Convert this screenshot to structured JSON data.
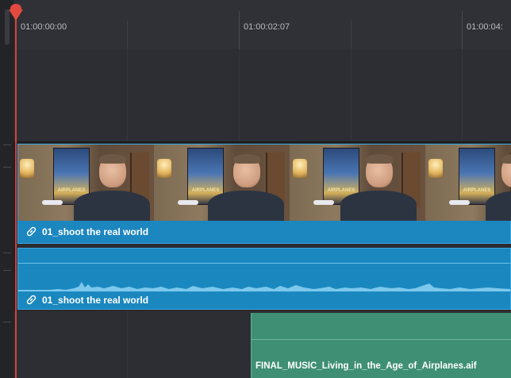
{
  "timeline": {
    "ruler": {
      "timecodes": [
        "01:00:00:00",
        "01:00:02:07",
        "01:00:04:"
      ]
    },
    "video_track": {
      "clip_name": "01_shoot the real world",
      "thumbnail_poster_text": "AIRPLANES"
    },
    "audio_track_1": {
      "clip_name": "01_shoot the real world"
    },
    "audio_track_2": {
      "clip_name": "FINAL_MUSIC_Living_in_the_Age_of_Airplanes.aif"
    }
  },
  "colors": {
    "playhead": "#e24a3f",
    "video_clip": "#1a7fb3",
    "audio_clip": "#1a88bf",
    "music_clip": "#3f8f74"
  },
  "icons": {
    "clip_link": "link-icon"
  }
}
